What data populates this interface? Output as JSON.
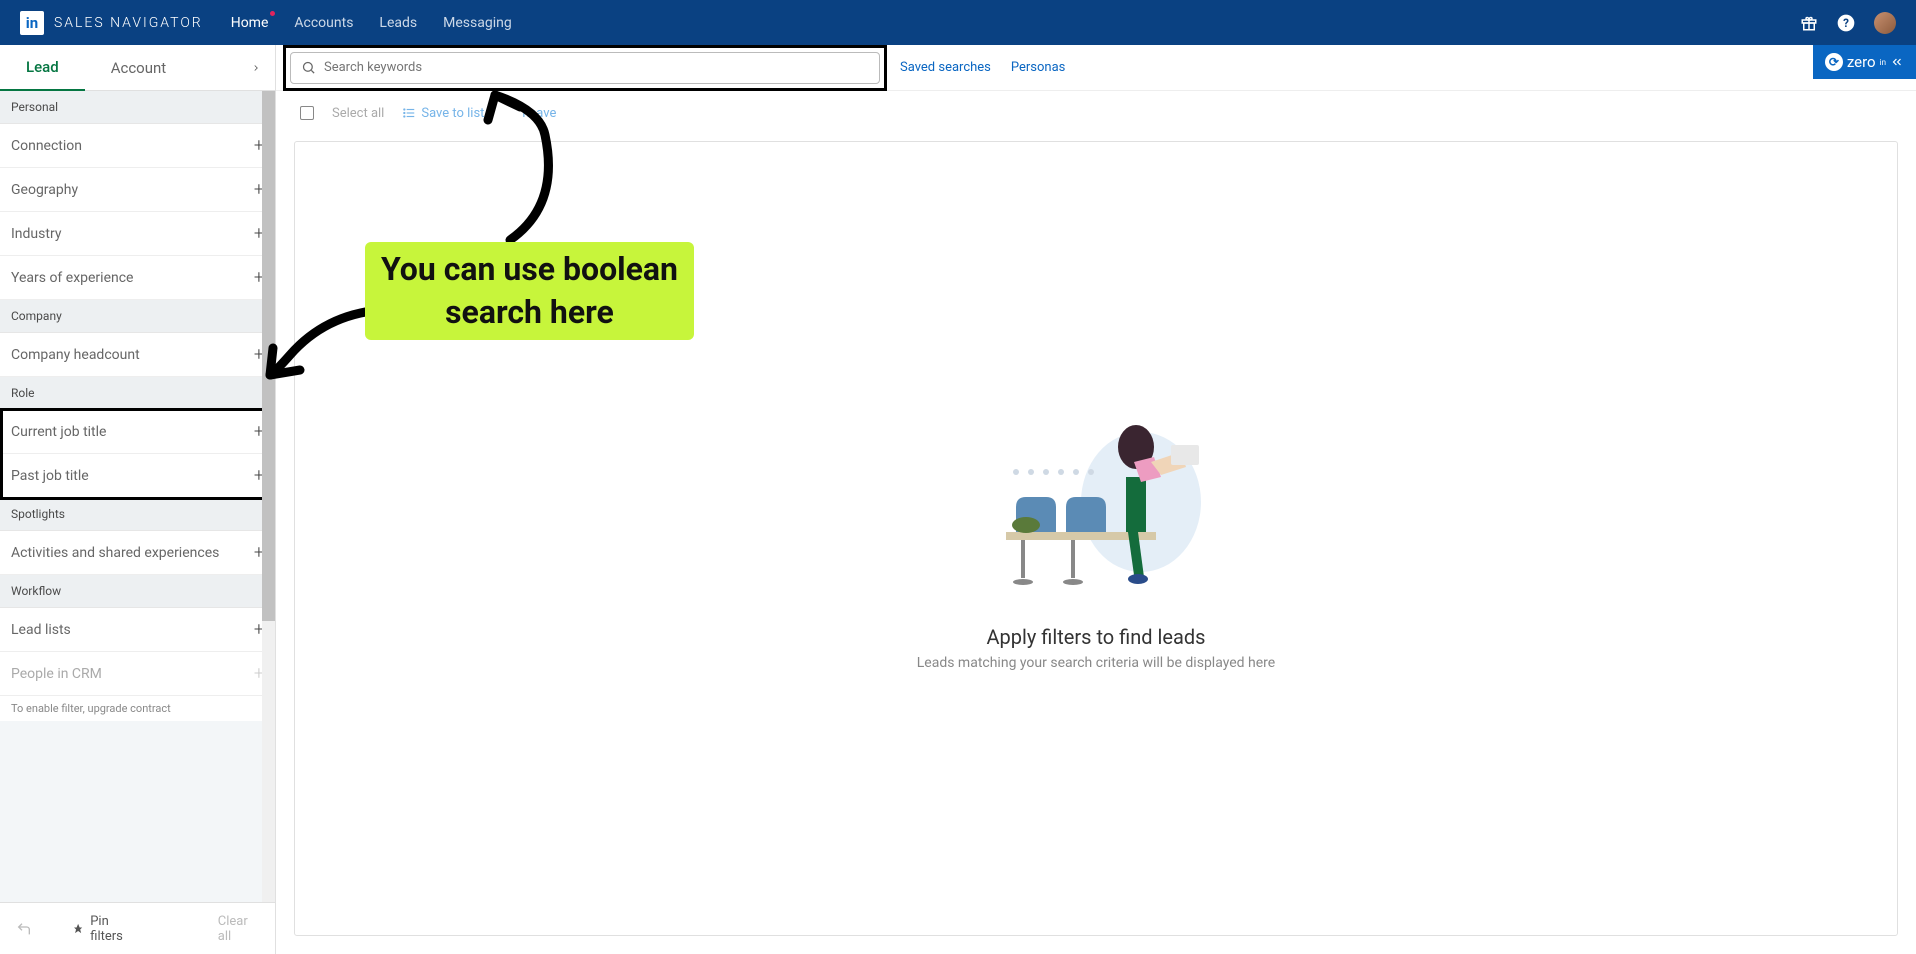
{
  "nav": {
    "brand": "SALES NAVIGATOR",
    "home": "Home",
    "accounts": "Accounts",
    "leads": "Leads",
    "messaging": "Messaging"
  },
  "zero": {
    "label": "zero",
    "sup": "in"
  },
  "tabs": {
    "lead": "Lead",
    "account": "Account"
  },
  "sections": {
    "personal": "Personal",
    "company": "Company",
    "role": "Role",
    "spotlights": "Spotlights",
    "workflow": "Workflow"
  },
  "filters": {
    "connection": "Connection",
    "geography": "Geography",
    "industry": "Industry",
    "years_exp": "Years of experience",
    "headcount": "Company headcount",
    "current_title": "Current job title",
    "past_title": "Past job title",
    "activities": "Activities and shared experiences",
    "lead_lists": "Lead lists",
    "people_crm": "People in CRM",
    "upgrade_note": "To enable filter, upgrade contract"
  },
  "footer": {
    "pin": "Pin filters",
    "clear": "Clear all"
  },
  "search": {
    "placeholder": "Search keywords",
    "saved": "Saved searches",
    "personas": "Personas"
  },
  "actions": {
    "select_all": "Select all",
    "save_list": "Save to list",
    "unsave": "nsave"
  },
  "empty": {
    "title": "Apply filters to find leads",
    "sub": "Leads matching your search criteria will be displayed here"
  },
  "annotation": {
    "line1": "You can use boolean",
    "line2": "search here"
  }
}
